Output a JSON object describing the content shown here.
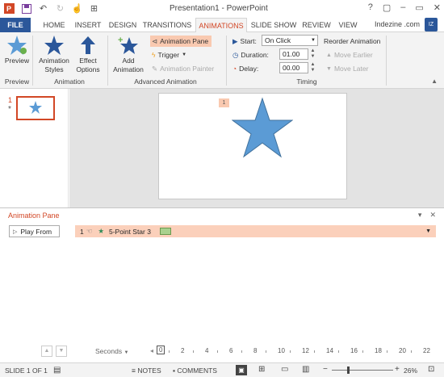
{
  "window": {
    "title": "Presentation1 - PowerPoint",
    "controls": [
      "?",
      "▢",
      "–",
      "▭",
      "✕"
    ]
  },
  "tabs": {
    "file": "FILE",
    "home": "HOME",
    "insert": "INSERT",
    "design": "DESIGN",
    "transitions": "TRANSITIONS",
    "animations": "ANIMATIONS",
    "slideshow": "SLIDE SHOW",
    "review": "REVIEW",
    "view": "VIEW"
  },
  "user": {
    "name": "Indezine .com",
    "avatar": "IZ"
  },
  "ribbon": {
    "preview": {
      "label": "Preview",
      "group": "Preview"
    },
    "animation": {
      "styles": "Animation Styles",
      "effect": "Effect Options",
      "group": "Animation"
    },
    "advanced": {
      "add": "Add Animation",
      "pane": "Animation Pane",
      "trigger": "Trigger",
      "painter": "Animation Painter",
      "group": "Advanced Animation"
    },
    "timing": {
      "start_label": "Start:",
      "start_value": "On Click",
      "duration_label": "Duration:",
      "duration_value": "01.00",
      "delay_label": "Delay:",
      "delay_value": "00.00",
      "reorder": "Reorder Animation",
      "earlier": "Move Earlier",
      "later": "Move Later",
      "group": "Timing"
    }
  },
  "thumb": {
    "number": "1",
    "star": "*"
  },
  "slide": {
    "anim_tag": "1"
  },
  "pane": {
    "title": "Animation Pane",
    "play_from": "Play From",
    "item": {
      "number": "1",
      "label": "5-Point Star 3",
      "bar_color": "#a9d18e"
    },
    "seconds": "Seconds",
    "ticks": [
      "0",
      "2",
      "4",
      "6",
      "8",
      "10",
      "12",
      "14",
      "16",
      "18",
      "20",
      "22"
    ]
  },
  "status": {
    "slide": "SLIDE 1 OF 1",
    "notes": "NOTES",
    "comments": "COMMENTS",
    "zoom": "26%"
  },
  "colors": {
    "accent": "#d24726",
    "file_tab": "#2b579a",
    "star": "#5b9bd5",
    "thumb_border": "#d24726"
  }
}
